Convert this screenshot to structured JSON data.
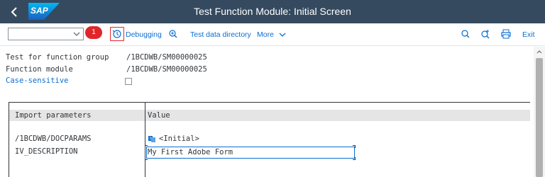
{
  "shell": {
    "title": "Test Function Module: Initial Screen",
    "logo_text": "SAP"
  },
  "toolbar": {
    "select_value": "",
    "step_badge": "1",
    "debugging_label": "Debugging",
    "test_data_directory_label": "Test data directory",
    "more_label": "More",
    "exit_label": "Exit"
  },
  "fields": {
    "function_group_label": "Test for function group",
    "function_group_value": "/1BCDWB/SM00000025",
    "function_module_label": "Function module",
    "function_module_value": "/1BCDWB/SM00000025",
    "case_sensitive_label": "Case-sensitive",
    "case_sensitive_checked": false
  },
  "table": {
    "headers": [
      "Import parameters",
      "Value"
    ],
    "rows": [
      {
        "param": "/1BCDWB/DOCPARAMS",
        "value": "<Initial>"
      },
      {
        "param": "IV_DESCRIPTION",
        "value": "My First Adobe Form"
      }
    ]
  },
  "colors": {
    "shell_bg": "#354a5f",
    "accent": "#0a6ed1",
    "highlight_red": "#e0262b"
  },
  "icons": [
    "back-icon",
    "sap-logo",
    "chevron-down-icon",
    "debugging-icon",
    "zoom-icon",
    "search-icon",
    "search-next-icon",
    "print-icon",
    "initial-value-icon"
  ]
}
